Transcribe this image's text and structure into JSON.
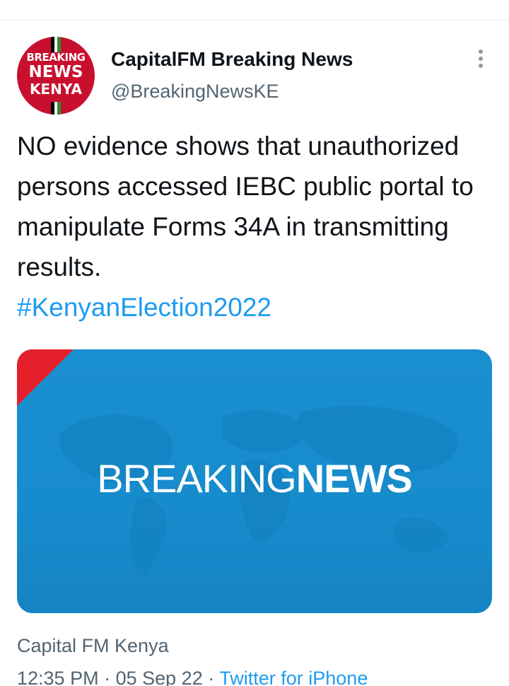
{
  "author": {
    "name": "CapitalFM Breaking News",
    "handle": "@BreakingNewsKE",
    "avatar_text": [
      "BREAKING",
      "NEWS",
      "KENYA"
    ]
  },
  "tweet": {
    "text": "NO evidence shows that unauthorized persons accessed IEBC public portal to manipulate Forms 34A in transmitting results.",
    "hashtag": "#KenyanElection2022"
  },
  "media": {
    "headline_light": "BREAKING",
    "headline_bold": "NEWS"
  },
  "footer": {
    "source": "Capital FM Kenya",
    "time": "12:35 PM",
    "separator": "·",
    "date": "05 Sep 22",
    "client": "Twitter for iPhone"
  },
  "icons": {
    "more": "more-vertical-icon"
  },
  "colors": {
    "accent": "#1d9bf0",
    "avatar_red": "#c8102e",
    "media_blue": "#178ccc",
    "corner_red": "#e4202b"
  }
}
